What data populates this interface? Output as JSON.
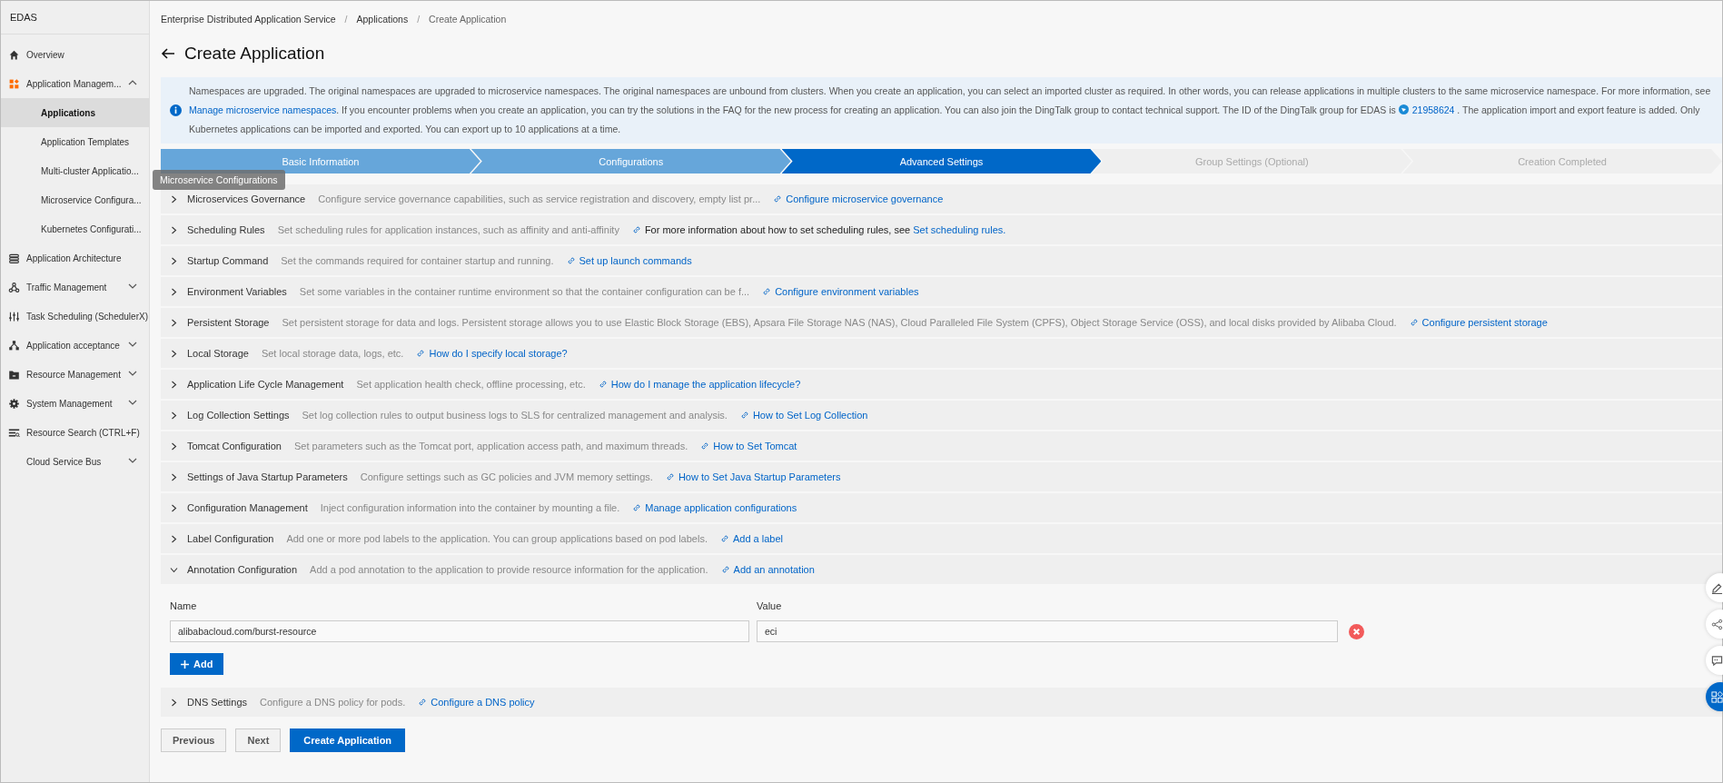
{
  "sidebar": {
    "title": "EDAS",
    "items": [
      {
        "label": "Overview",
        "selected": false
      },
      {
        "label": "Application Managem...",
        "expanded": true,
        "selected": false,
        "children": [
          {
            "label": "Applications",
            "selected": true
          },
          {
            "label": "Application Templates",
            "selected": false
          },
          {
            "label": "Multi-cluster Applicatio...",
            "selected": false
          },
          {
            "label": "Microservice Configura...",
            "selected": false
          },
          {
            "label": "Kubernetes Configurati...",
            "selected": false
          }
        ]
      },
      {
        "label": "Application Architecture",
        "selected": false
      },
      {
        "label": "Traffic Management",
        "expanded": false,
        "selected": false
      },
      {
        "label": "Task Scheduling (SchedulerX)",
        "selected": false
      },
      {
        "label": "Application acceptance",
        "expanded": false,
        "selected": false
      },
      {
        "label": "Resource Management",
        "expanded": false,
        "selected": false
      },
      {
        "label": "System Management",
        "expanded": false,
        "selected": false
      },
      {
        "label": "Resource Search (CTRL+F)",
        "selected": false
      },
      {
        "label": "Cloud Service Bus",
        "expanded": false,
        "selected": false
      }
    ],
    "tooltip": "Microservice Configurations"
  },
  "breadcrumb": [
    {
      "kind": "link",
      "text": "Enterprise Distributed Application Service"
    },
    {
      "kind": "separator",
      "text": "/"
    },
    {
      "kind": "link",
      "text": "Applications"
    },
    {
      "kind": "separator",
      "text": "/"
    },
    {
      "kind": "current",
      "text": "Create Application"
    }
  ],
  "title": "Create Application",
  "notice": [
    {
      "kind": "text",
      "text": "Namespaces are upgraded. The original namespaces are upgraded to microservice namespaces. The original namespaces are unbound from clusters. When you create an application, you can select an imported cluster as required. In other words, you can release applications in multiple clusters to the same microservice namespace. For more information, see "
    },
    {
      "kind": "link",
      "text": "Manage microservice namespaces"
    },
    {
      "kind": "text",
      "text": ". If you encounter problems when you create an application, you can try the solutions in the FAQ for the new process for creating an application. You can also join the DingTalk group to contact technical support. The ID of the DingTalk group for EDAS is "
    },
    {
      "kind": "group",
      "text": "21958624"
    },
    {
      "kind": "text",
      "text": " . The application import and export feature is added. Only Kubernetes applications can be imported and exported. You can export up to 10 applications at a time."
    }
  ],
  "steps": [
    {
      "label": "Basic Information",
      "done": true,
      "selected": false
    },
    {
      "label": "Configurations",
      "done": true,
      "selected": false
    },
    {
      "label": "Advanced Settings",
      "done": false,
      "selected": true
    },
    {
      "label": "Group Settings (Optional)",
      "done": false,
      "selected": false
    },
    {
      "label": "Creation Completed",
      "done": false,
      "selected": false
    }
  ],
  "sections": [
    {
      "title": "Microservices Governance",
      "description": "Configure service governance capabilities, such as service registration and discovery, empty list pr...",
      "link": "Configure microservice governance",
      "expanded": false
    },
    {
      "title": "Scheduling Rules",
      "description": "Set scheduling rules for application instances, such as affinity and anti-affinity",
      "note": "For more information about how to set scheduling rules, see ",
      "link": "Set scheduling rules.",
      "expanded": false
    },
    {
      "title": "Startup Command",
      "description": "Set the commands required for container startup and running.",
      "link": "Set up launch commands",
      "expanded": false
    },
    {
      "title": "Environment Variables",
      "description": "Set some variables in the container runtime environment so that the container configuration can be f...",
      "link": "Configure environment variables",
      "expanded": false
    },
    {
      "title": "Persistent Storage",
      "description": "Set persistent storage for data and logs. Persistent storage allows you to use Elastic Block Storage (EBS), Apsara File Storage NAS (NAS), Cloud Paralleled File System (CPFS), Object Storage Service (OSS), and local disks provided by Alibaba Cloud.",
      "link": "Configure persistent storage",
      "expanded": false
    },
    {
      "title": "Local Storage",
      "description": "Set local storage data, logs, etc.",
      "link": "How do I specify local storage?",
      "expanded": false
    },
    {
      "title": "Application Life Cycle Management",
      "description": "Set application health check, offline processing, etc.",
      "link": "How do I manage the application lifecycle?",
      "expanded": false
    },
    {
      "title": "Log Collection Settings",
      "description": "Set log collection rules to output business logs to SLS for centralized management and analysis.",
      "link": "How to Set Log Collection",
      "expanded": false
    },
    {
      "title": "Tomcat Configuration",
      "description": "Set parameters such as the Tomcat port, application access path, and maximum threads.",
      "link": "How to Set Tomcat",
      "expanded": false
    },
    {
      "title": "Settings of Java Startup Parameters",
      "description": "Configure settings such as GC policies and JVM memory settings.",
      "link": "How to Set Java Startup Parameters",
      "expanded": false
    },
    {
      "title": "Configuration Management",
      "description": "Inject configuration information into the container by mounting a file.",
      "link": "Manage application configurations",
      "expanded": false
    },
    {
      "title": "Label Configuration",
      "description": "Add one or more pod labels to the application. You can group applications based on pod labels.",
      "link": "Add a label",
      "expanded": false
    },
    {
      "title": "Annotation Configuration",
      "description": "Add a pod annotation to the application to provide resource information for the application.",
      "link": "Add an annotation",
      "expanded": true,
      "table": {
        "columns": [
          "Name",
          "Value"
        ],
        "rows": [
          {
            "name": "alibabacloud.com/burst-resource",
            "value": "eci"
          }
        ],
        "add_button": "Add"
      }
    },
    {
      "title": "DNS Settings",
      "description": "Configure a DNS policy for pods.",
      "link": "Configure a DNS policy",
      "expanded": false
    }
  ],
  "footer_buttons": [
    {
      "label": "Previous",
      "kind": "secondary"
    },
    {
      "label": "Next",
      "kind": "secondary"
    },
    {
      "label": "Create Application",
      "kind": "primary"
    }
  ]
}
